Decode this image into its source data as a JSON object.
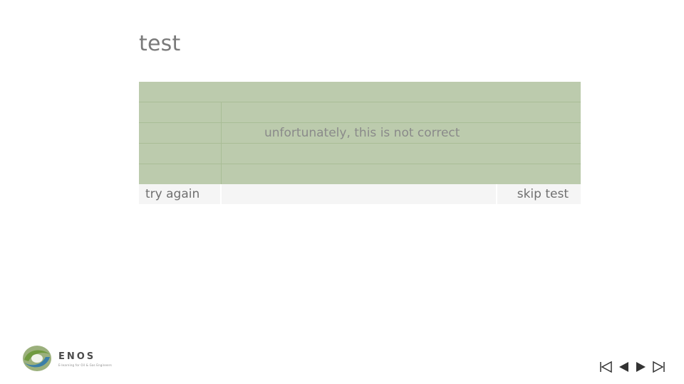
{
  "slide": {
    "title": "test"
  },
  "quiz": {
    "feedback": "unfortunately, this is not correct",
    "try_again_label": "try again",
    "skip_label": "skip test"
  },
  "colors": {
    "green_fill": "#bccbad",
    "green_line": "#a9bd96",
    "footer_cell": "#f5f5f5",
    "text_gray": "#7a7a7a"
  },
  "logo": {
    "name": "ENOS",
    "tagline": "E-learning for Oil & Gas Engineers",
    "icon": "enos-logo-icon"
  },
  "navigation": {
    "first_icon": "first-slide-icon",
    "prev_icon": "previous-slide-icon",
    "next_icon": "next-slide-icon",
    "last_icon": "last-slide-icon"
  }
}
